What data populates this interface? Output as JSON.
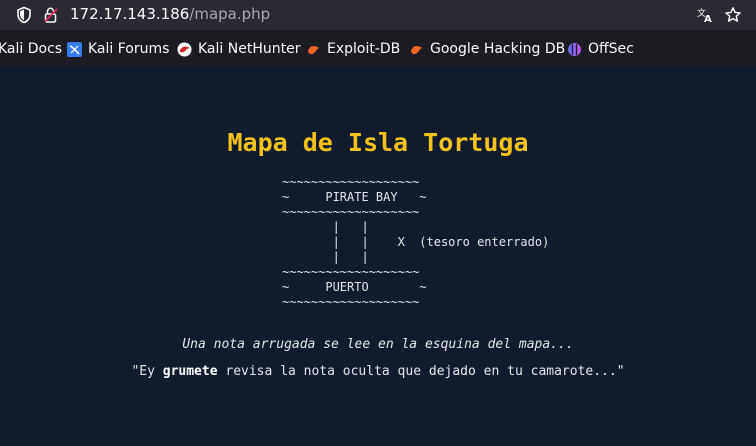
{
  "browser": {
    "url_host": "172.17.143.186",
    "url_path": "/mapa.php",
    "icons": [
      "shield-icon",
      "lock-icon",
      "translate-icon",
      "star-icon"
    ]
  },
  "bookmarks": [
    {
      "label": "Kali Docs",
      "icon": "kali-docs-favicon"
    },
    {
      "label": "Kali Forums",
      "icon": "kali-forums-favicon"
    },
    {
      "label": "Kali NetHunter",
      "icon": "kali-nethunter-favicon"
    },
    {
      "label": "Exploit-DB",
      "icon": "exploit-db-favicon"
    },
    {
      "label": "Google Hacking DB",
      "icon": "ghdb-favicon"
    },
    {
      "label": "OffSec",
      "icon": "offsec-favicon"
    }
  ],
  "page": {
    "title": "Mapa de Isla Tortuga",
    "ascii_map": "~~~~~~~~~~~~~~~~~~~\n~     PIRATE BAY   ~\n~~~~~~~~~~~~~~~~~~~\n       |   |\n       |   |    X  (tesoro enterrado)\n       |   |\n~~~~~~~~~~~~~~~~~~~\n~     PUERTO       ~\n~~~~~~~~~~~~~~~~~~~",
    "note": "Una nota arrugada se lee en la esquina del mapa...",
    "quote_prefix": "\"Ey ",
    "quote_bold": "grumete",
    "quote_suffix": " revisa la nota oculta que dejado en tu camarote...\""
  },
  "colors": {
    "page_bg": "#101b2d",
    "title": "#f4c21b",
    "chrome_bg": "#1c1b22"
  }
}
